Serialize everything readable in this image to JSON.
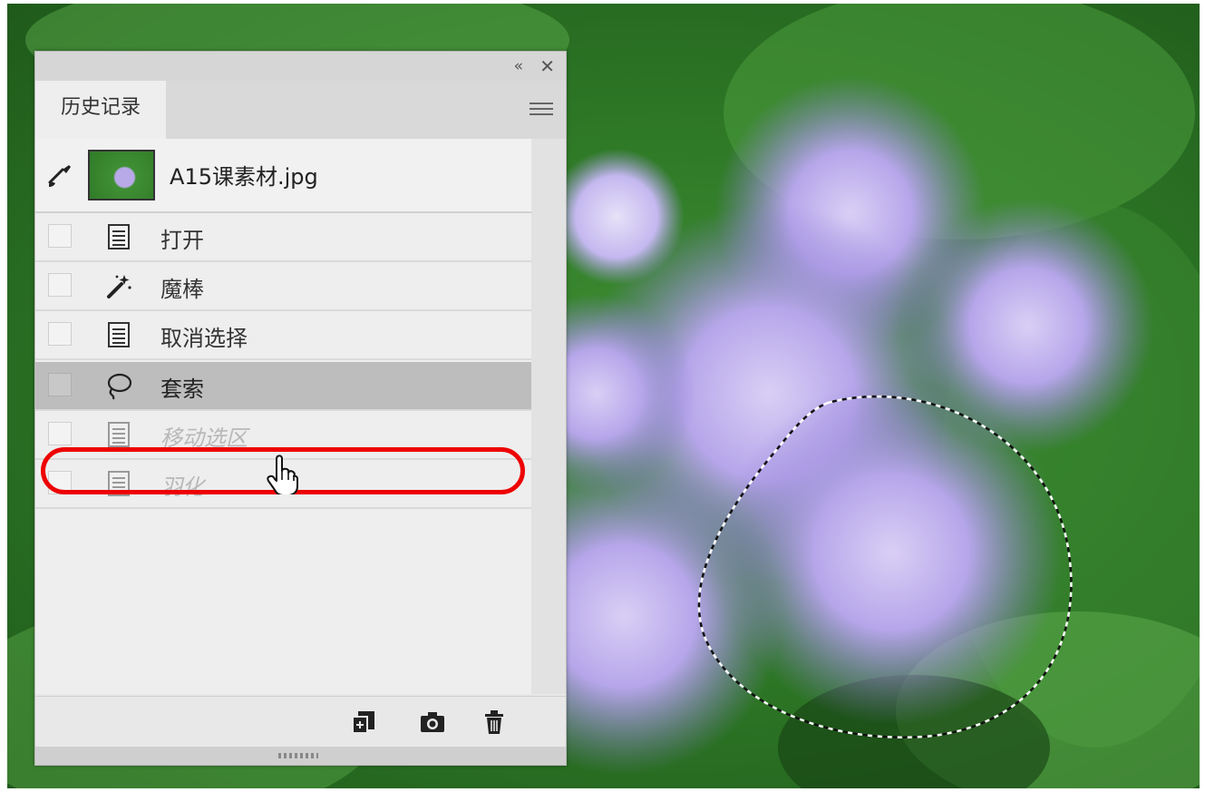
{
  "panel": {
    "tab_label": "历史记录",
    "collapse_label": "«",
    "close_label": "✕",
    "snapshot": {
      "label": "A15课素材.jpg"
    },
    "steps": [
      {
        "label": "打开",
        "icon": "document-icon",
        "state": "normal"
      },
      {
        "label": "魔棒",
        "icon": "magic-wand-icon",
        "state": "normal"
      },
      {
        "label": "取消选择",
        "icon": "document-icon",
        "state": "normal"
      },
      {
        "label": "套索",
        "icon": "lasso-icon",
        "state": "selected"
      },
      {
        "label": "移动选区",
        "icon": "document-icon",
        "state": "dimmed"
      },
      {
        "label": "羽化",
        "icon": "document-icon",
        "state": "dimmed"
      }
    ],
    "footer": [
      "new-document-icon",
      "camera-icon",
      "trash-icon"
    ]
  },
  "colors": {
    "highlight": "#e00000",
    "selected_row": "#bdbdbd",
    "leaf": "#2f7a27",
    "flower": "#b8a9e8"
  }
}
